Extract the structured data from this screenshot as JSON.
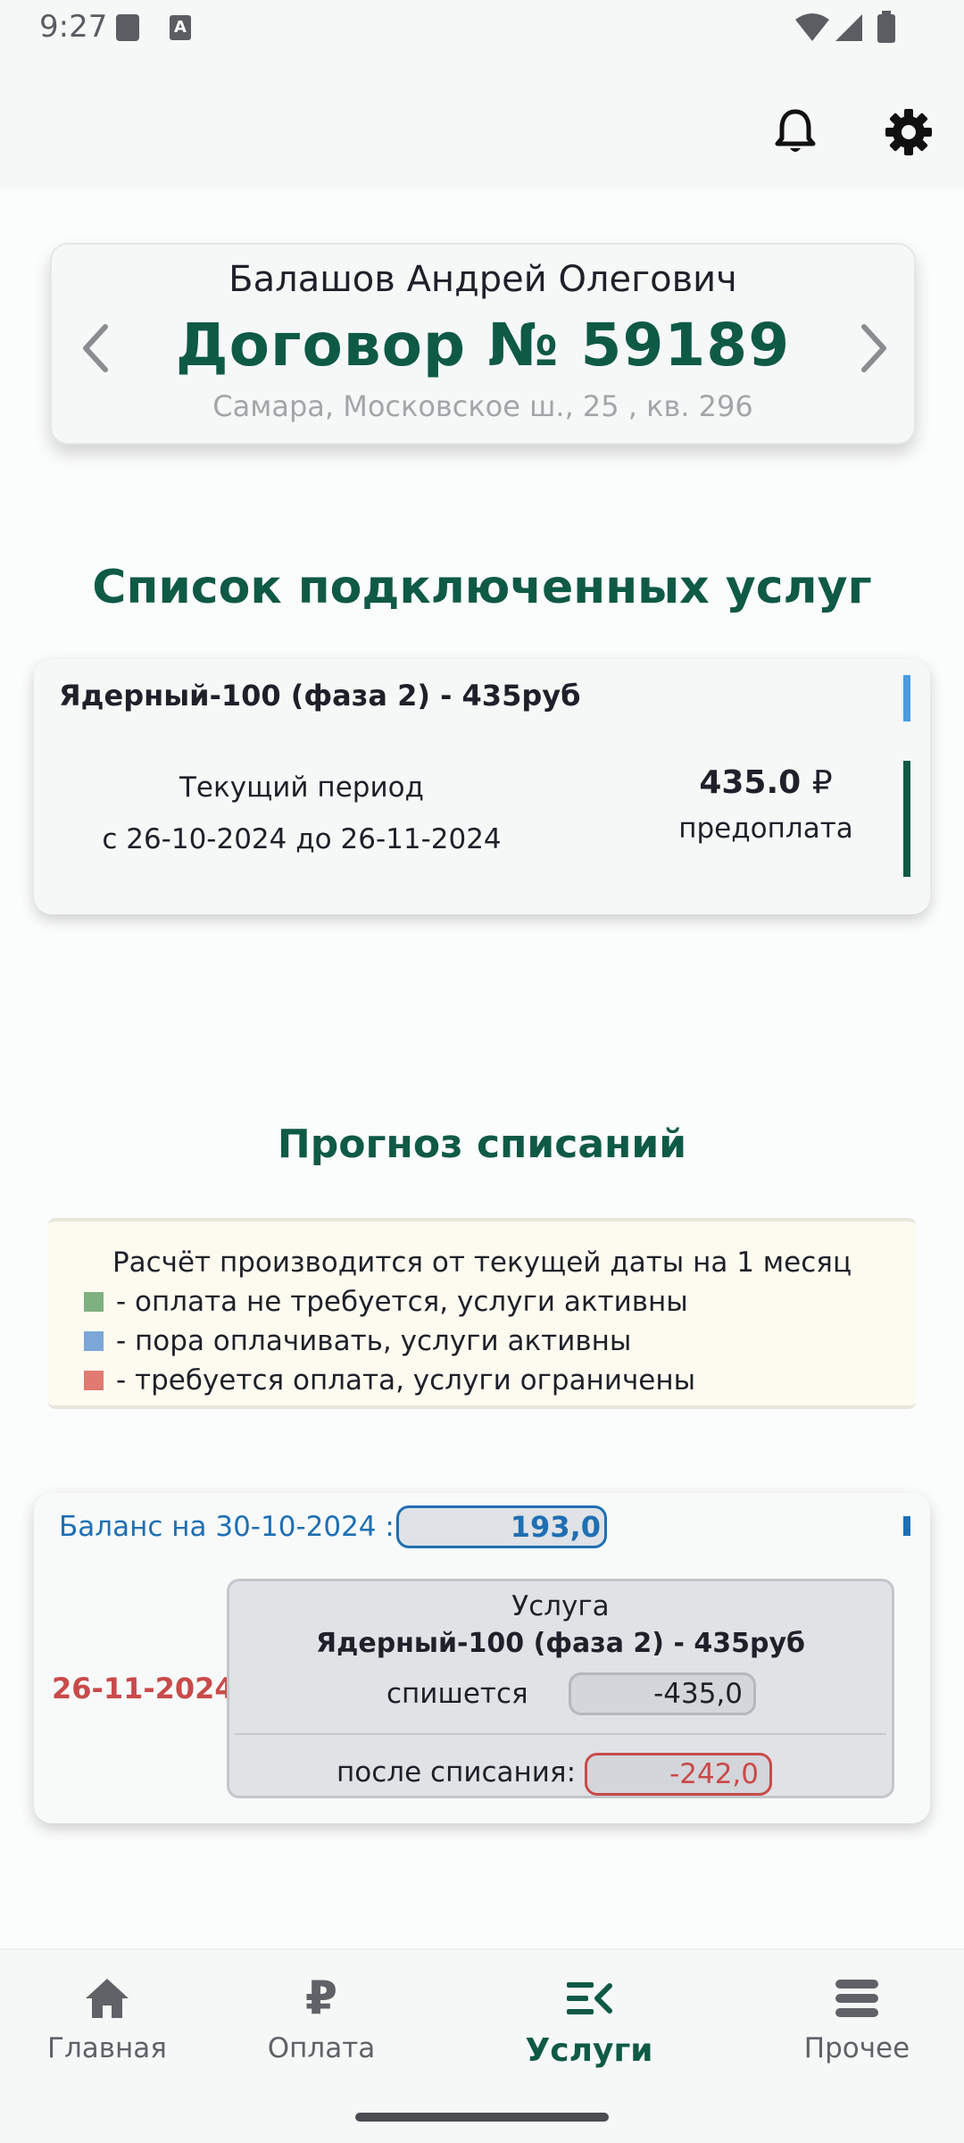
{
  "status_bar": {
    "time": "9:27",
    "icons": [
      "sd-card-icon",
      "keyboard-a-icon",
      "wifi-icon",
      "signal-icon",
      "battery-icon"
    ],
    "keyboard_glyph": "A"
  },
  "header": {
    "actions": [
      "bell-icon",
      "gear-icon"
    ]
  },
  "contract": {
    "owner_name": "Балашов Андрей Олегович",
    "number_label": "Договор  №  59189",
    "address": "Самара, Московское ш., 25 , кв. 296"
  },
  "services_section": {
    "title": "Список подключенных услуг",
    "items": [
      {
        "name": "Ядерный-100 (фаза 2) - 435руб",
        "period_label": "Текущий период",
        "period_range": "с 26-10-2024  до 26-11-2024",
        "price": "435.0",
        "currency": "₽",
        "payment_type": "предоплата"
      }
    ]
  },
  "forecast_section": {
    "title": "Прогноз списаний",
    "legend_note": "Расчёт производится от текущей даты на 1 месяц",
    "legend": [
      {
        "color": "#7fb07f",
        "text": "- оплата не требуется, услуги активны"
      },
      {
        "color": "#7aa6d8",
        "text": "- пора оплачивать, услуги активны"
      },
      {
        "color": "#e07a72",
        "text": "- требуется оплата, услуги ограничены"
      }
    ],
    "balance_label": "Баланс на 30-10-2024 :",
    "balance_value": "193,0",
    "charge": {
      "date": "26-11-2024",
      "service_label": "Услуга",
      "service_name": "Ядерный-100 (фаза 2) - 435руб",
      "debit_label": "спишется",
      "debit_value": "-435,0",
      "after_label": "после списания:",
      "after_value": "-242,0"
    }
  },
  "bottom_nav": {
    "items": [
      {
        "label": "Главная",
        "icon": "home-icon",
        "active": false
      },
      {
        "label": "Оплата",
        "icon": "ruble-icon",
        "active": false
      },
      {
        "label": "Услуги",
        "icon": "services-list-icon",
        "active": true
      },
      {
        "label": "Прочее",
        "icon": "menu-icon",
        "active": false
      }
    ],
    "ruble_glyph": "₽"
  },
  "colors": {
    "brand_green": "#0f5a45",
    "info_blue": "#1f6fb3",
    "alert_red": "#c94a4a"
  }
}
